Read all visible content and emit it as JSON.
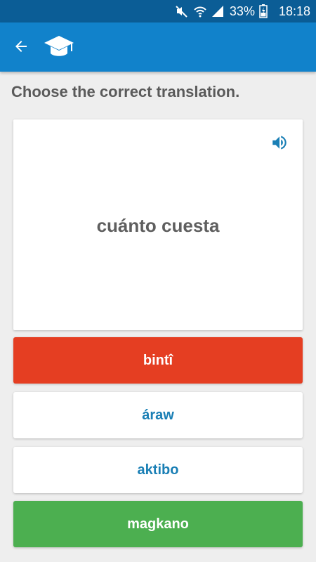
{
  "status_bar": {
    "battery_percent": "33%",
    "time": "18:18"
  },
  "app_bar": {
    "back_icon": "arrow-left-icon",
    "logo_icon": "graduation-cap-icon"
  },
  "quiz": {
    "prompt": "Choose the correct translation.",
    "word": "cuánto cuesta",
    "speaker_icon": "speaker-icon",
    "answers": [
      {
        "label": "bintî",
        "state": "wrong"
      },
      {
        "label": "áraw",
        "state": "neutral"
      },
      {
        "label": "aktibo",
        "state": "neutral"
      },
      {
        "label": "magkano",
        "state": "correct"
      }
    ]
  },
  "colors": {
    "status_bar": "#0b5d96",
    "app_bar": "#1182cb",
    "wrong": "#e53e22",
    "correct": "#4caf50",
    "answer_text": "#1a7fb5"
  }
}
